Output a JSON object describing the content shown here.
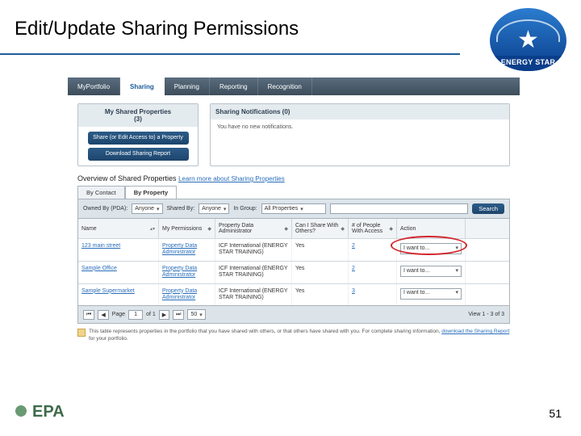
{
  "slide": {
    "title": "Edit/Update Sharing Permissions",
    "page_number": "51"
  },
  "logos": {
    "energy_star": "ENERGY STAR",
    "epa": "EPA"
  },
  "tabs": {
    "portfolio": "MyPortfolio",
    "sharing": "Sharing",
    "planning": "Planning",
    "reporting": "Reporting",
    "recognition": "Recognition"
  },
  "left_panel": {
    "title_line1": "My Shared Properties",
    "title_line2": "(3)",
    "btn_share": "Share (or Edit Access to) a Property",
    "btn_download": "Download Sharing Report"
  },
  "notif_panel": {
    "title": "Sharing Notifications (0)",
    "body": "You have no new notifications."
  },
  "overview": {
    "label": "Overview of Shared Properties",
    "link": "Learn more about Sharing Properties"
  },
  "subtabs": {
    "by_contact": "By Contact",
    "by_property": "By Property"
  },
  "filter": {
    "owned_by_label": "Owned By (PDA):",
    "owned_by_value": "Anyone",
    "shared_by_label": "Shared By:",
    "shared_by_value": "Anyone",
    "in_group_label": "In Group:",
    "in_group_value": "All Properties",
    "search_btn": "Search"
  },
  "grid_headers": {
    "name": "Name",
    "my_perm": "My Permissions",
    "pda": "Property Data Administrator",
    "can_share": "Can I Share With Others?",
    "num_people": "# of People With Access",
    "action": "Action"
  },
  "rows": [
    {
      "name": "123 main street",
      "my_perm": "Property Data Administrator",
      "pda": "ICF International (ENERGY STAR TRAINING)",
      "can_share": "Yes",
      "num_people": "2",
      "action": "I want to..."
    },
    {
      "name": "Sample Office",
      "my_perm": "Property Data Administrator",
      "pda": "ICF International (ENERGY STAR TRAINING)",
      "can_share": "Yes",
      "num_people": "2",
      "action": "I want to..."
    },
    {
      "name": "Sample Supermarket",
      "my_perm": "Property Data Administrator",
      "pda": "ICF International (ENERGY STAR TRAINING)",
      "can_share": "Yes",
      "num_people": "3",
      "action": "I want to..."
    }
  ],
  "pager": {
    "page_label": "Page",
    "page_num": "1",
    "of_label": "of 1",
    "per_page": "50",
    "view_text": "View 1 - 3 of 3"
  },
  "footnote": {
    "text_a": "This table represents properties in the portfolio that you have shared with others, or that others have shared with you. For complete sharing information, ",
    "link": "download the Sharing Report",
    "text_b": " for your portfolio."
  }
}
